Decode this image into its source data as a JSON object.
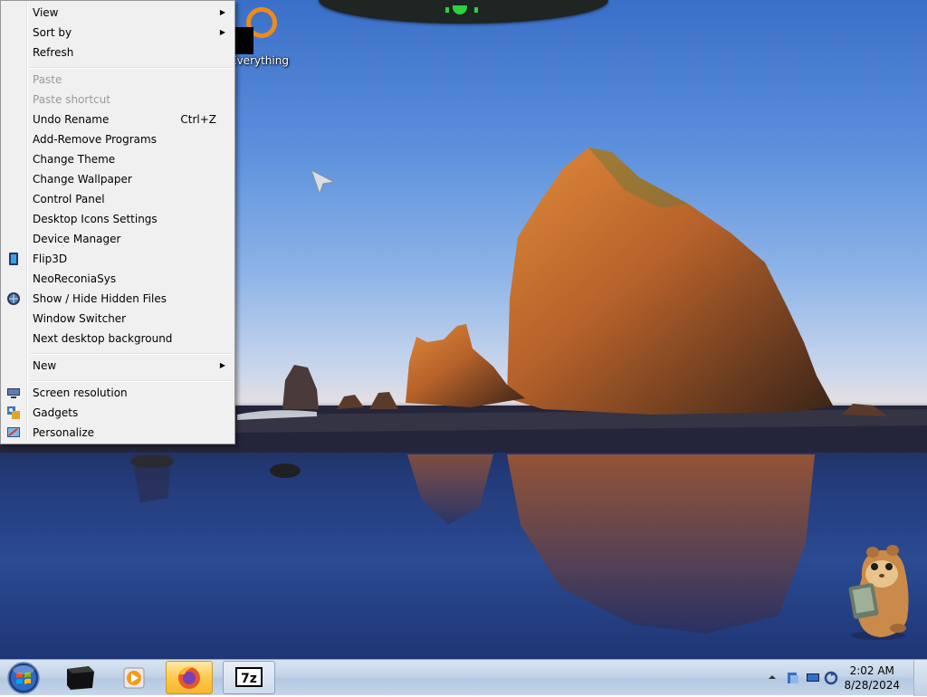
{
  "desktop": {
    "icons": [
      {
        "label": "Everything"
      }
    ]
  },
  "context_menu": {
    "items": [
      {
        "label": "View",
        "submenu": true
      },
      {
        "label": "Sort by",
        "submenu": true
      },
      {
        "label": "Refresh"
      },
      {
        "label": "Paste",
        "disabled": true
      },
      {
        "label": "Paste shortcut",
        "disabled": true
      },
      {
        "label": "Undo Rename",
        "shortcut": "Ctrl+Z"
      },
      {
        "label": "Add-Remove Programs"
      },
      {
        "label": "Change Theme"
      },
      {
        "label": "Change Wallpaper"
      },
      {
        "label": "Control Panel"
      },
      {
        "label": "Desktop Icons Settings"
      },
      {
        "label": "Device Manager"
      },
      {
        "label": "Flip3D",
        "icon": "flip3d-icon"
      },
      {
        "label": "NeoReconiaSys"
      },
      {
        "label": "Show / Hide Hidden Files",
        "icon": "globe-icon"
      },
      {
        "label": "Window Switcher"
      },
      {
        "label": "Next desktop background"
      },
      {
        "label": "New",
        "submenu": true
      },
      {
        "label": "Screen resolution",
        "icon": "display-icon"
      },
      {
        "label": "Gadgets",
        "icon": "gadgets-icon"
      },
      {
        "label": "Personalize",
        "icon": "personalize-icon"
      }
    ]
  },
  "taskbar": {
    "buttons": [
      {
        "icon": "start-orb-icon"
      },
      {
        "icon": "terminal-icon"
      },
      {
        "icon": "media-player-icon"
      },
      {
        "icon": "firefox-icon",
        "active": true
      },
      {
        "icon": "7zip-icon"
      }
    ],
    "tray": {
      "icons": [
        "show-hidden-icons-arrow",
        "network-icon",
        "monitor-icon",
        "sync-icon"
      ],
      "time": "2:02 AM",
      "date": "8/28/2024"
    }
  }
}
